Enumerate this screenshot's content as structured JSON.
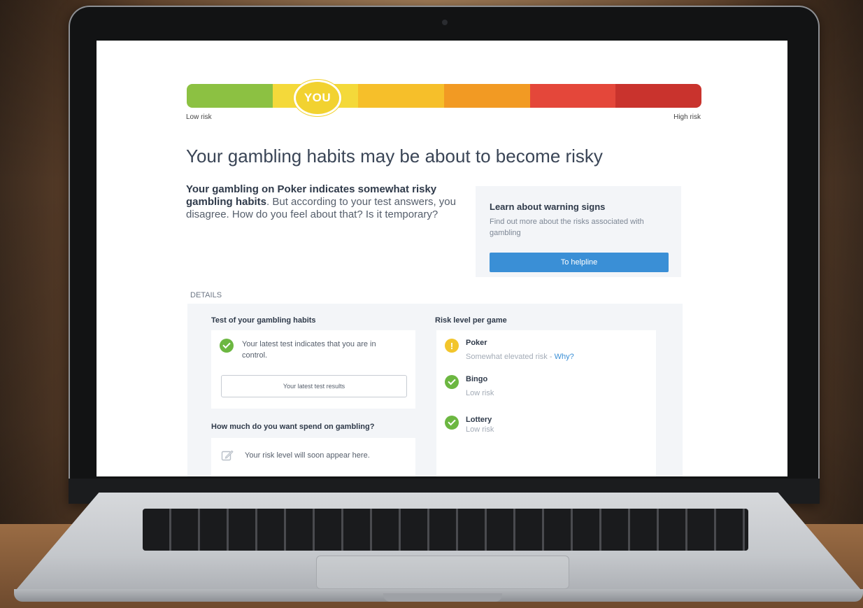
{
  "scale": {
    "marker": "YOU",
    "low_label": "Low risk",
    "high_label": "High risk",
    "level": 0.25,
    "colors": [
      "#8cc142",
      "#f4d93a",
      "#f6bf2a",
      "#f29a23",
      "#e4473a",
      "#c9332d"
    ]
  },
  "headline": "Your gambling habits may be about to become risky",
  "intro": {
    "bold": "Your gambling on Poker indicates somewhat risky gambling habits",
    "rest": ". But according to your test answers, you disagree. How do you feel about that? Is it temporary?"
  },
  "warning_card": {
    "title": "Learn about warning signs",
    "text": "Find out more about the risks associated with gambling",
    "button": "To helpline"
  },
  "details": {
    "label": "DETAILS",
    "test": {
      "title": "Test of your gambling habits",
      "status": "Your latest test indicates that you are in control.",
      "button": "Your latest test results"
    },
    "spend": {
      "title": "How much do you want spend on gambling?",
      "text": "Your risk level will soon appear here."
    },
    "risk": {
      "title": "Risk level per game",
      "games": [
        {
          "name": "Poker",
          "risk": "Somewhat elevated risk",
          "link": "Why?",
          "icon": "warning-icon"
        },
        {
          "name": "Bingo",
          "risk": "Low risk",
          "icon": "check-icon"
        },
        {
          "name": "Lottery",
          "risk": "Low risk",
          "icon": "check-icon"
        }
      ]
    }
  },
  "colors": {
    "accent": "#3a8fd6",
    "success": "#6cb741",
    "warning": "#f2c52c"
  }
}
